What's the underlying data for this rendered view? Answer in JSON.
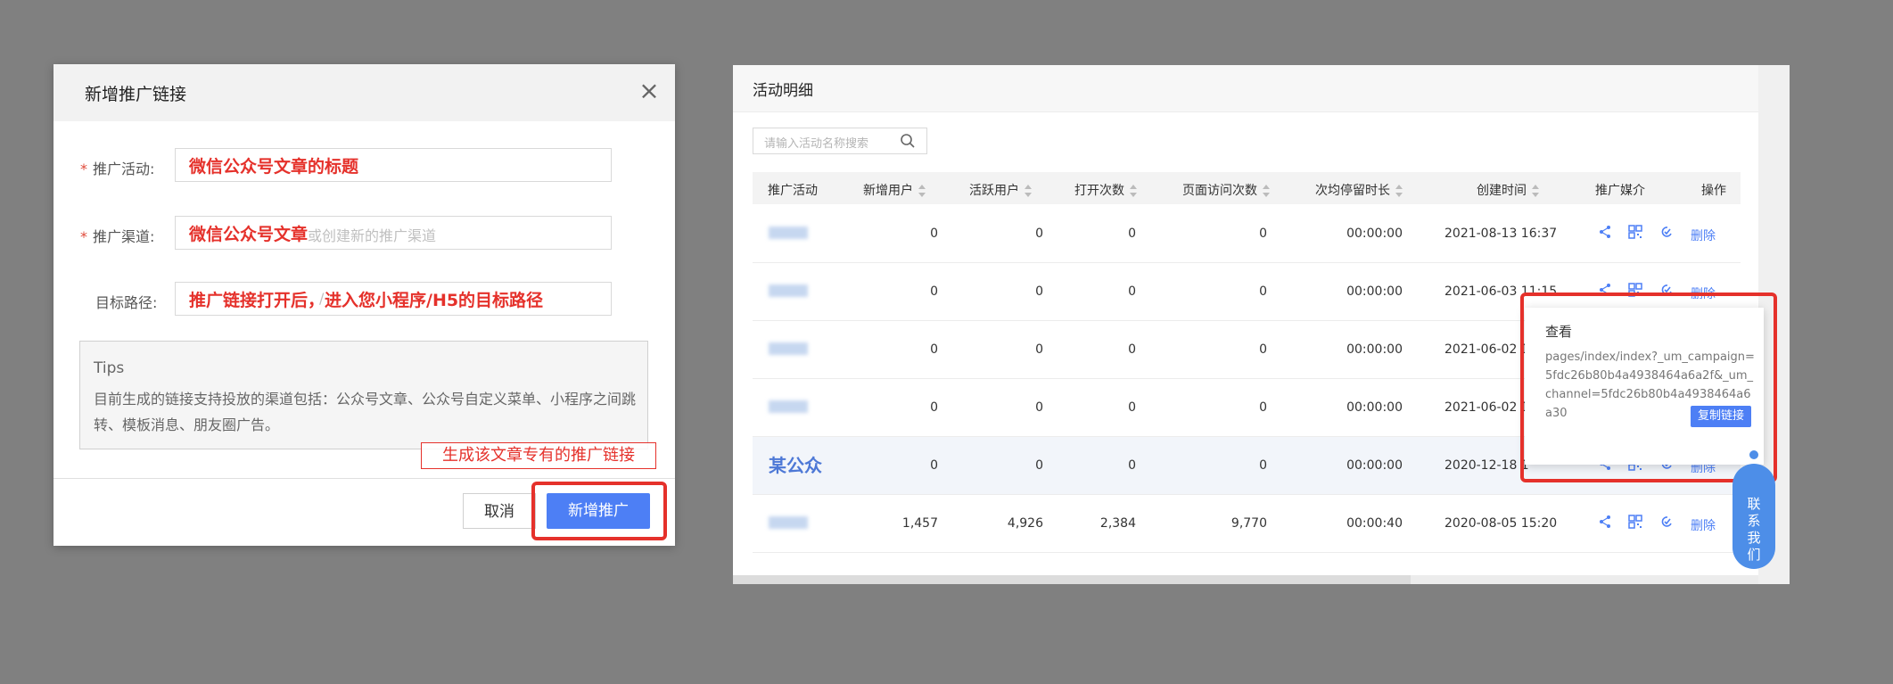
{
  "dialog": {
    "title": "新增推广链接",
    "fields": [
      {
        "label": "推广活动:",
        "required": true,
        "value": "",
        "annotation": "微信公众号文章的标题"
      },
      {
        "label": "推广渠道:",
        "required": true,
        "placeholder_visible": "或创建新的推广渠道",
        "annotation": "微信公众号文章"
      },
      {
        "label": "目标路径:",
        "required": false,
        "placeholder_visible": "/",
        "annotation": "推广链接打开后，进入您小程序/H5的目标路径"
      }
    ],
    "tips": {
      "title": "Tips",
      "body": "目前生成的链接支持投放的渠道包括：公众号文章、公众号自定义菜单、小程序之间跳转、模板消息、朋友圈广告。"
    },
    "annotation_label": "生成该文章专有的推广链接",
    "buttons": {
      "cancel": "取消",
      "create": "新增推广"
    }
  },
  "panel": {
    "title": "活动明细",
    "search_placeholder": "请输入活动名称搜索",
    "columns": [
      "推广活动",
      "新增用户",
      "活跃用户",
      "打开次数",
      "页面访问次数",
      "次均停留时长",
      "创建时间",
      "推广媒介",
      "操作"
    ],
    "rows": [
      {
        "name": "",
        "new_users": "0",
        "active_users": "0",
        "opens": "0",
        "page_visits": "0",
        "avg_stay": "00:00:00",
        "created": "2021-08-13 16:37",
        "action": "删除"
      },
      {
        "name": "",
        "new_users": "0",
        "active_users": "0",
        "opens": "0",
        "page_visits": "0",
        "avg_stay": "00:00:00",
        "created": "2021-06-03 11:15",
        "action": "删除"
      },
      {
        "name": "",
        "new_users": "0",
        "active_users": "0",
        "opens": "0",
        "page_visits": "0",
        "avg_stay": "00:00:00",
        "created": "2021-06-02 1",
        "action": ""
      },
      {
        "name": "",
        "new_users": "0",
        "active_users": "0",
        "opens": "0",
        "page_visits": "0",
        "avg_stay": "00:00:00",
        "created": "2021-06-02 1",
        "action": ""
      },
      {
        "name": "某公众",
        "new_users": "0",
        "active_users": "0",
        "opens": "0",
        "page_visits": "0",
        "avg_stay": "00:00:00",
        "created": "2020-12-18 1",
        "action": "删除"
      },
      {
        "name": "",
        "new_users": "1,457",
        "active_users": "4,926",
        "opens": "2,384",
        "page_visits": "9,770",
        "avg_stay": "00:00:40",
        "created": "2020-08-05 15:20",
        "action": "删除"
      }
    ],
    "popover": {
      "title": "查看",
      "url": "pages/index/index?_um_campaign=5fdc26b80b4a4938464a6a2f&_um_channel=5fdc26b80b4a4938464a6a30",
      "copy_button": "复制链接"
    },
    "contact": "联系我们",
    "accent": "#4d7ff5",
    "annotation_color": "#e5312b"
  }
}
